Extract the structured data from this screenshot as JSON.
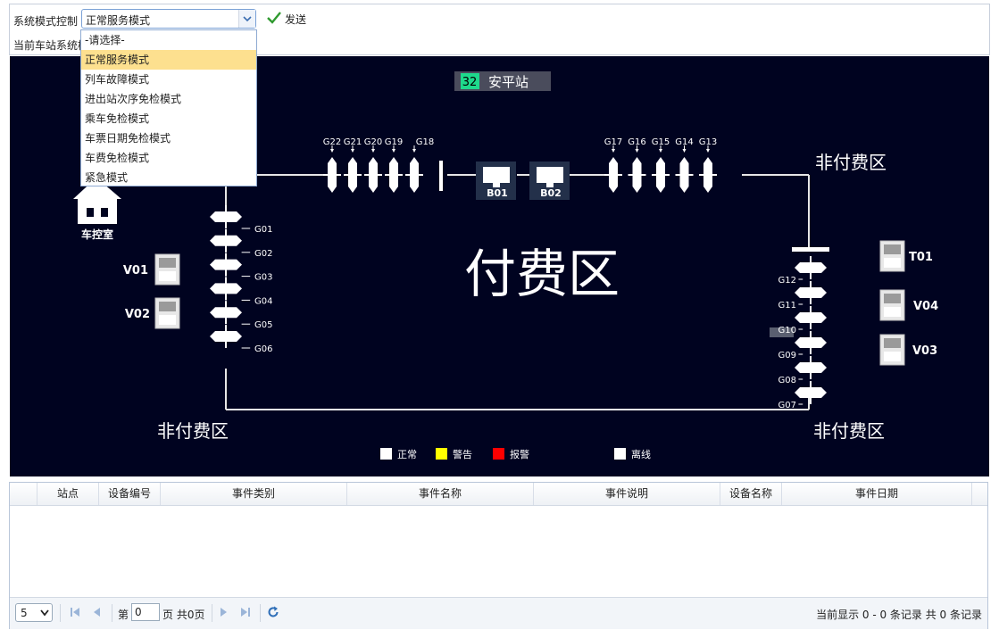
{
  "control": {
    "mode_label": "系统模式控制",
    "selected_mode": "正常服务模式",
    "send_label": "发送",
    "station_status_label": "当前车站系统模",
    "options": [
      "-请选择-",
      "正常服务模式",
      "列车故障模式",
      "进出站次序免检模式",
      "乘车免检模式",
      "车票日期免检模式",
      "车费免检模式",
      "紧急模式"
    ]
  },
  "map": {
    "station_number": "32",
    "station_name": "安平站",
    "paid_area_label": "付费区",
    "unpaid_area_label": "非付费区",
    "control_room_label": "车控室",
    "bom": [
      "B01",
      "B02"
    ],
    "top_left_gates": [
      "G22",
      "G21",
      "G20",
      "G19",
      "G18"
    ],
    "top_right_gates": [
      "G17",
      "G16",
      "G15",
      "G14",
      "G13"
    ],
    "left_gates": [
      "G01",
      "G02",
      "G03",
      "G04",
      "G05",
      "G06"
    ],
    "right_gates": [
      "G12",
      "G11",
      "G10",
      "G09",
      "G08",
      "G07"
    ],
    "tvm_left": [
      "V01",
      "V02"
    ],
    "tvm_right": [
      "T01",
      "V04",
      "V03"
    ],
    "legend": [
      {
        "label": "正常",
        "color": "#ffffff"
      },
      {
        "label": "警告",
        "color": "#ffff00"
      },
      {
        "label": "报警",
        "color": "#ff0000"
      },
      {
        "label": "离线",
        "color": "#ffffff"
      }
    ],
    "colors": {
      "background": "#000320",
      "station_number_bg": "#1ed98c",
      "device": "#ffffff"
    }
  },
  "table": {
    "columns": [
      "站点",
      "设备编号",
      "事件类别",
      "事件名称",
      "事件说明",
      "设备名称",
      "事件日期"
    ],
    "rows": []
  },
  "pager": {
    "page_size": "5",
    "page_prefix": "第",
    "page_value": "0",
    "page_suffix": "页 共0页",
    "info": "当前显示 0 - 0 条记录 共 0 条记录"
  }
}
